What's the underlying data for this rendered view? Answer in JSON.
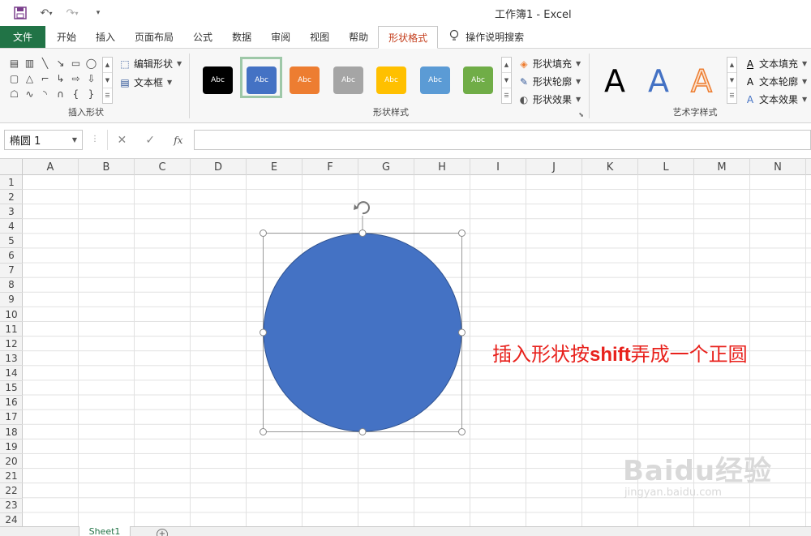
{
  "window": {
    "title": "工作簿1  -  Excel"
  },
  "qat": {
    "undo_arrow": "▾",
    "redo_arrow": "▾",
    "customize": "▾"
  },
  "tabs": [
    {
      "label": "文件"
    },
    {
      "label": "开始"
    },
    {
      "label": "插入"
    },
    {
      "label": "页面布局"
    },
    {
      "label": "公式"
    },
    {
      "label": "数据"
    },
    {
      "label": "审阅"
    },
    {
      "label": "视图"
    },
    {
      "label": "帮助"
    },
    {
      "label": "形状格式"
    }
  ],
  "tell_me": "操作说明搜索",
  "ribbon": {
    "insert_shapes": {
      "label": "插入形状",
      "edit_shape": "编辑形状",
      "text_box": "文本框"
    },
    "shape_styles": {
      "label": "形状样式",
      "swatch_text": "Abc",
      "swatches": [
        "#000000",
        "#4472c4",
        "#ed7d31",
        "#a5a5a5",
        "#ffc000",
        "#5b9bd5",
        "#70ad47"
      ],
      "fill": "形状填充",
      "outline": "形状轮廓",
      "effects": "形状效果"
    },
    "wordart": {
      "label": "艺术字样式",
      "letter": "A",
      "fill": "文本填充",
      "outline": "文本轮廓",
      "effects": "文本效果"
    }
  },
  "formula_bar": {
    "name_box": "椭圆 1",
    "cancel": "✕",
    "enter": "✓",
    "fx": "fx",
    "formula": ""
  },
  "columns": [
    "A",
    "B",
    "C",
    "D",
    "E",
    "F",
    "G",
    "H",
    "I",
    "J",
    "K",
    "L",
    "M",
    "N"
  ],
  "rows": [
    "1",
    "2",
    "3",
    "4",
    "5",
    "6",
    "7",
    "8",
    "9",
    "10",
    "11",
    "12",
    "13",
    "14",
    "15",
    "16",
    "17",
    "18",
    "19",
    "20",
    "21",
    "22",
    "23",
    "24"
  ],
  "shape": {
    "fill": "#4472c4",
    "outline": "#2f528f"
  },
  "annotation": {
    "before": "插入形状按",
    "bold": "shift",
    "after": "弄成一个正圆"
  },
  "sheets": [
    {
      "name": "Sheet1"
    }
  ],
  "add_sheet": "+",
  "watermark": {
    "brand": "Baidu经验",
    "url": "jingyan.baidu.com"
  }
}
